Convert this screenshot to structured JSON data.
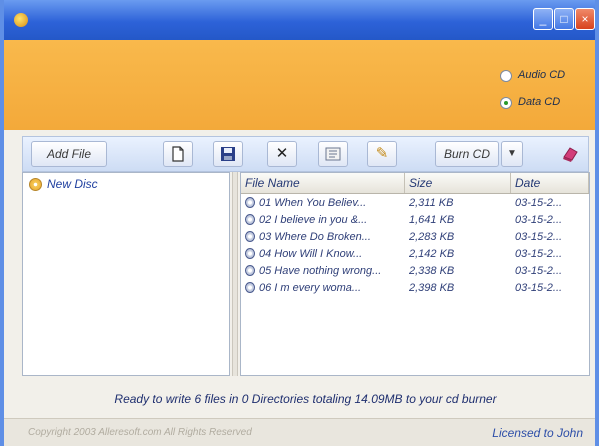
{
  "window": {
    "title": "",
    "controls": {
      "minimize": "_",
      "maximize": "□",
      "close": "×"
    },
    "accent_color": "#2d62d8"
  },
  "welcome": {
    "title": "",
    "description": "",
    "background_color": "#f3a93a",
    "mode_options": [
      {
        "label": "Audio CD",
        "selected": false
      },
      {
        "label": "Data CD",
        "selected": true
      }
    ]
  },
  "toolbar": {
    "add_file_label": "Add File",
    "burn_label": "Burn CD",
    "burn_dropdown_icon": "chevron-down",
    "icons": [
      "new-document-icon",
      "save-icon",
      "delete-icon",
      "properties-icon",
      "erase-icon",
      "close-app-icon"
    ]
  },
  "tree": {
    "items": [
      {
        "label": "New Disc",
        "icon": "cd-icon"
      }
    ]
  },
  "file_table": {
    "columns": [
      "File Name",
      "Size",
      "Date"
    ],
    "rows": [
      {
        "name": "01 When You Believ...",
        "size": "2,311 KB",
        "date": "03-15-2..."
      },
      {
        "name": "02 I believe in you &...",
        "size": "1,641 KB",
        "date": "03-15-2..."
      },
      {
        "name": "03 Where Do Broken...",
        "size": "2,283 KB",
        "date": "03-15-2..."
      },
      {
        "name": "04 How Will I Know...",
        "size": "2,142 KB",
        "date": "03-15-2..."
      },
      {
        "name": "05 Have nothing wrong...",
        "size": "2,338 KB",
        "date": "03-15-2..."
      },
      {
        "name": "06 I m every woma...",
        "size": "2,398 KB",
        "date": "03-15-2..."
      }
    ]
  },
  "status_text": "Ready to write 6 files in 0 Directories totaling 14.09MB to your cd burner",
  "footer": {
    "copyright": "Copyright 2003 Alleresoft.com All Rights Reserved",
    "license": "Licensed to John"
  }
}
